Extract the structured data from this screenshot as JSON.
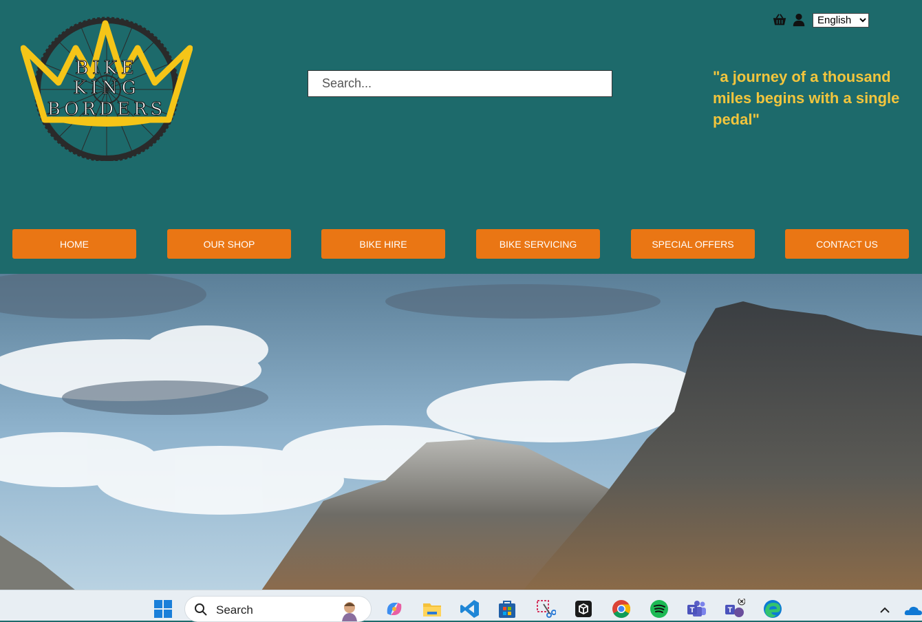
{
  "logo": {
    "line1": "BIKE",
    "line2": "KING",
    "line3": "BORDERS"
  },
  "search": {
    "placeholder": "Search..."
  },
  "header_icons": [
    "basket-icon",
    "user-icon"
  ],
  "language": {
    "selected": "English"
  },
  "quote": "\"a journey of a thousand miles begins with a single pedal\"",
  "nav": {
    "items": [
      {
        "label": "HOME"
      },
      {
        "label": "OUR SHOP"
      },
      {
        "label": "BIKE HIRE"
      },
      {
        "label": "BIKE SERVICING"
      },
      {
        "label": "SPECIAL OFFERS"
      },
      {
        "label": "CONTACT US"
      }
    ]
  },
  "taskbar": {
    "search_label": "Search",
    "apps": [
      "windows-start-icon",
      "copilot-icon",
      "file-explorer-icon",
      "vscode-icon",
      "store-icon",
      "snipping-tool-icon",
      "terminal-icon",
      "chrome-icon",
      "spotify-icon",
      "teams-icon",
      "teams-classic-icon",
      "edge-icon",
      "chevron-up-icon",
      "onedrive-icon"
    ]
  },
  "colors": {
    "header_bg": "#1d6a6b",
    "nav_button": "#ea7614",
    "quote_text": "#f2c53d",
    "logo_crown": "#f5c518"
  }
}
